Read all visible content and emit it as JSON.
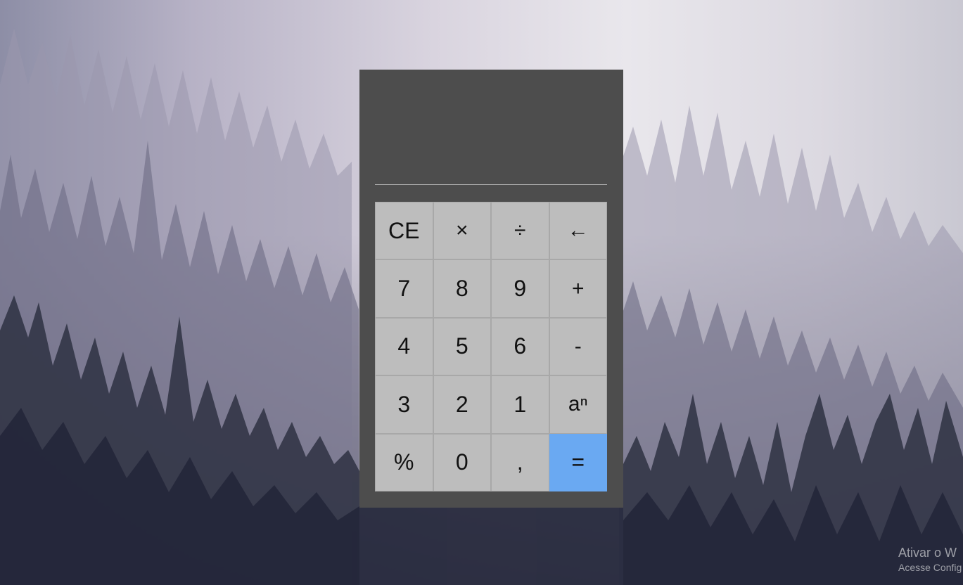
{
  "calculator": {
    "display_value": "",
    "keys": [
      {
        "label": "CE",
        "name": "clear-entry-button"
      },
      {
        "label": "×",
        "name": "multiply-button"
      },
      {
        "label": "÷",
        "name": "divide-button"
      },
      {
        "label": "←",
        "name": "backspace-button"
      },
      {
        "label": "7",
        "name": "digit-7-button"
      },
      {
        "label": "8",
        "name": "digit-8-button"
      },
      {
        "label": "9",
        "name": "digit-9-button"
      },
      {
        "label": "+",
        "name": "add-button"
      },
      {
        "label": "4",
        "name": "digit-4-button"
      },
      {
        "label": "5",
        "name": "digit-5-button"
      },
      {
        "label": "6",
        "name": "digit-6-button"
      },
      {
        "label": "-",
        "name": "subtract-button"
      },
      {
        "label": "3",
        "name": "digit-3-button"
      },
      {
        "label": "2",
        "name": "digit-2-button"
      },
      {
        "label": "1",
        "name": "digit-1-button"
      },
      {
        "label": "aⁿ",
        "name": "power-button"
      },
      {
        "label": "%",
        "name": "percent-button"
      },
      {
        "label": "0",
        "name": "digit-0-button"
      },
      {
        "label": ",",
        "name": "decimal-button"
      },
      {
        "label": "=",
        "name": "equals-button"
      }
    ],
    "colors": {
      "panel": "#4d4d4d",
      "key": "#bdbdbd",
      "equals": "#6aa9f2"
    }
  },
  "watermark": {
    "line1": "Ativar o W",
    "line2": "Acesse Config"
  }
}
